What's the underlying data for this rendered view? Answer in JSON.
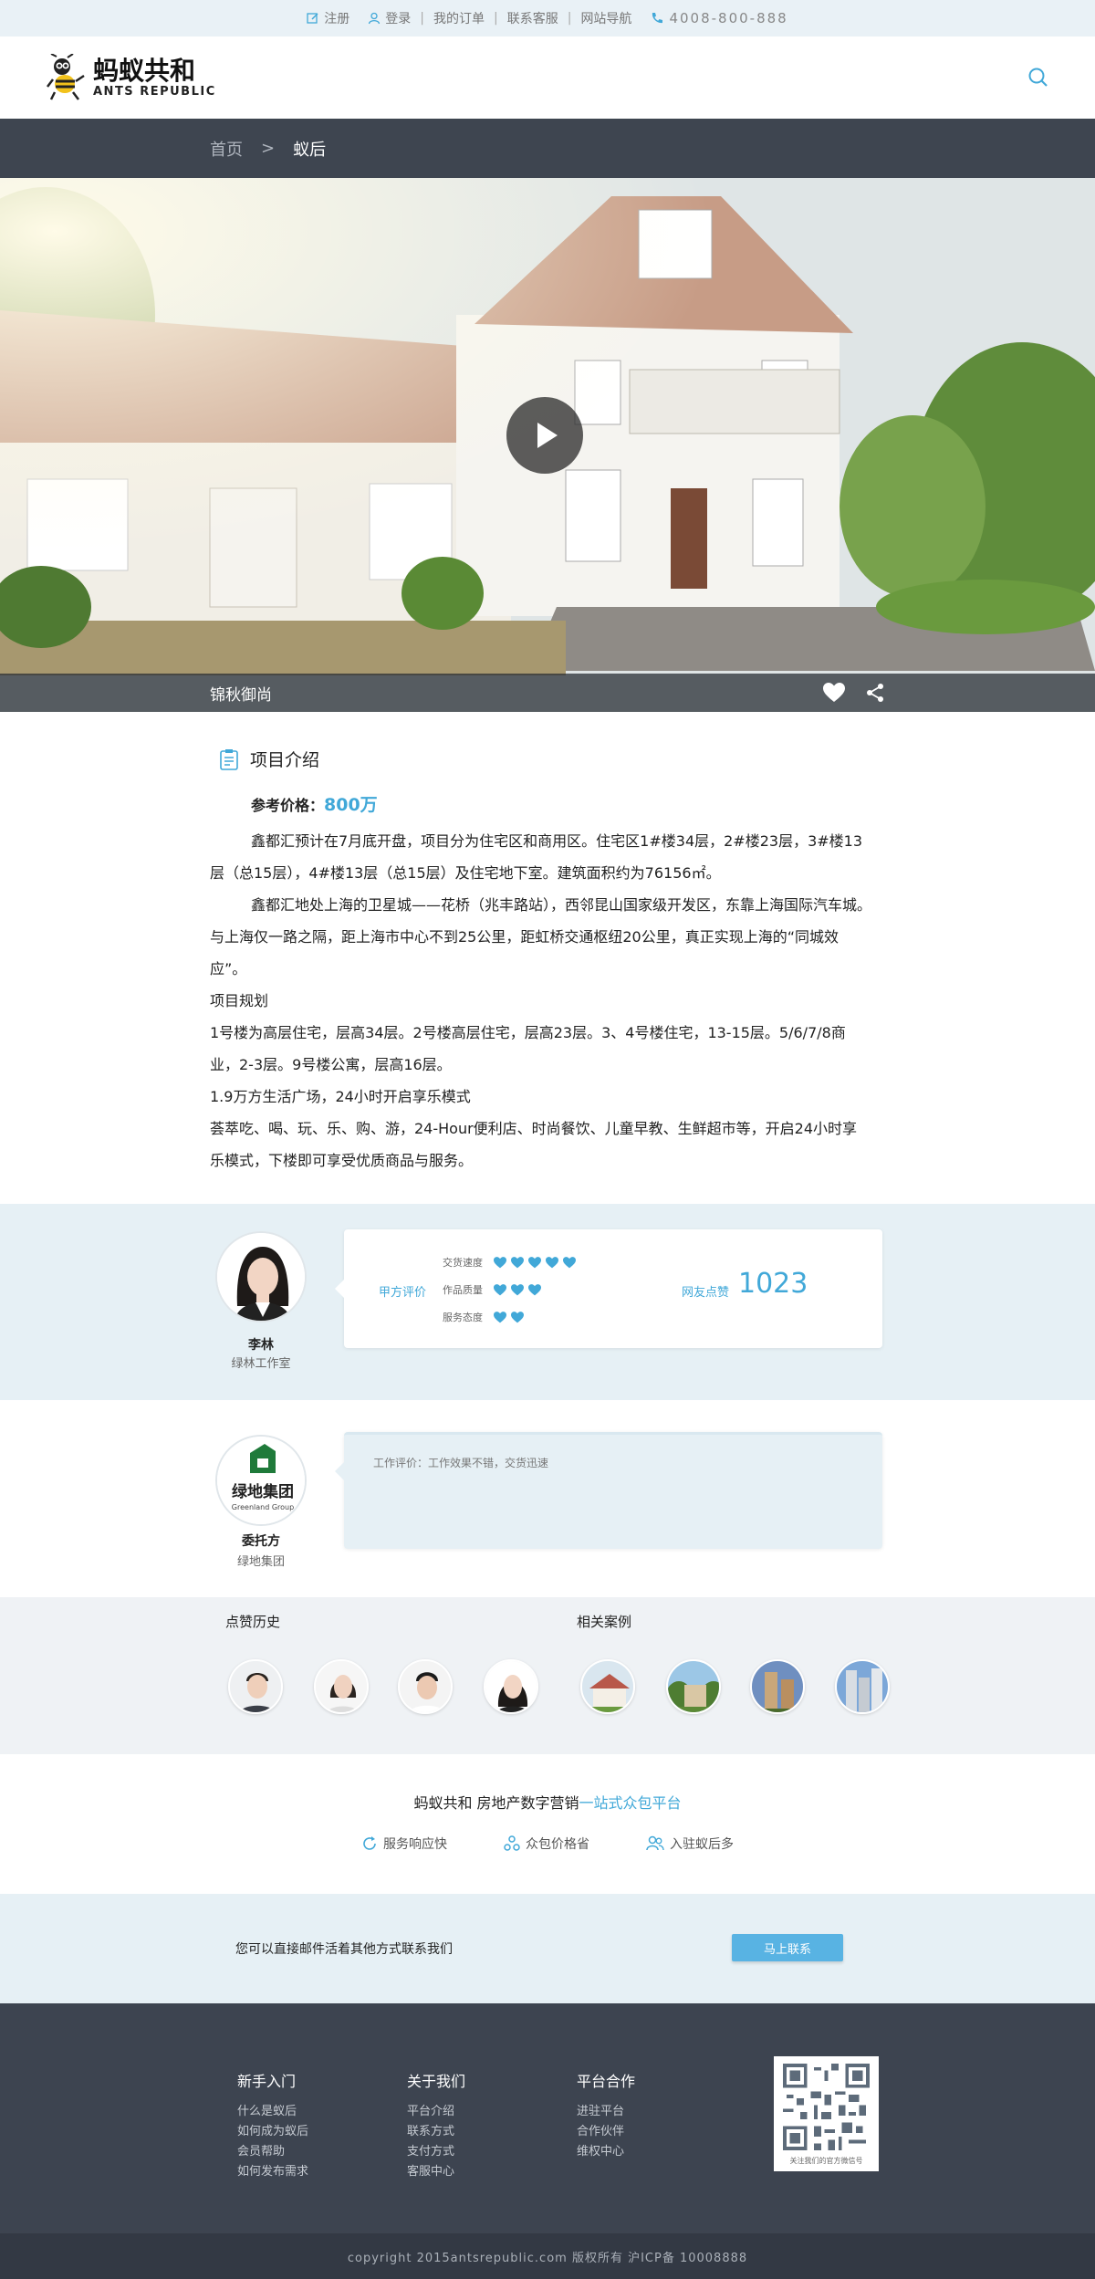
{
  "topbar": {
    "register": "注册",
    "login": "登录",
    "orders": "我的订单",
    "service": "联系客服",
    "sitenav": "网站导航",
    "phone": "4008-800-888"
  },
  "logo": {
    "cn": "蚂蚁共和",
    "en": "ANTS REPUBLIC"
  },
  "breadcrumb": {
    "home": "首页",
    "sep": ">",
    "current": "蚁后"
  },
  "hero": {
    "caption": "锦秋御尚"
  },
  "intro": {
    "title": "项目介绍",
    "price_label": "参考价格：",
    "price_value": "800万",
    "para1": "鑫都汇预计在7月底开盘，项目分为住宅区和商用区。住宅区1#楼34层，2#楼23层，3#楼13层（总15层），4#楼13层（总15层）及住宅地下室。建筑面积约为76156㎡。",
    "para2": "鑫都汇地处上海的卫星城——花桥（兆丰路站），西邻昆山国家级开发区，东靠上海国际汽车城。与上海仅一路之隔，距上海市中心不到25公里，距虹桥交通枢纽20公里，真正实现上海的“同城效应”。",
    "para3": "项目规划",
    "para4": "1号楼为高层住宅，层高34层。2号楼高层住宅，层高23层。3、4号楼住宅，13-15层。5/6/7/8商业，2-3层。9号楼公寓，层高16层。",
    "para5": "1.9万方生活广场，24小时开启享乐模式",
    "para6": "荟萃吃、喝、玩、乐、购、游，24-Hour便利店、时尚餐饮、儿童早教、生鲜超市等，开启24小时享乐模式，下楼即可享受优质商品与服务。"
  },
  "review1": {
    "name": "李林",
    "studio": "绿林工作室",
    "eval_label": "甲方评价",
    "ratings": [
      {
        "label": "交货速度",
        "value": 5
      },
      {
        "label": "作品质量",
        "value": 3
      },
      {
        "label": "服务态度",
        "value": 2
      }
    ],
    "likes_label": "网友点赞",
    "likes_value": "1023"
  },
  "review2": {
    "logo_cn": "绿地集团",
    "logo_en": "Greenland Group",
    "name": "委托方",
    "company": "绿地集团",
    "comment": "工作评价：工作效果不错，交货迅速"
  },
  "history": {
    "likes_title": "点赞历史",
    "cases_title": "相关案例"
  },
  "slogan": {
    "main": "蚂蚁共和 房地产数字营销",
    "highlight": "一站式众包平台",
    "features": [
      "服务响应快",
      "众包价格省",
      "入驻蚁后多"
    ]
  },
  "contact": {
    "text": "您可以直接邮件活着其他方式联系我们",
    "button": "马上联系"
  },
  "footer": {
    "col1": {
      "title": "新手入门",
      "items": [
        "什么是蚁后",
        "如何成为蚁后",
        "会员帮助",
        "如何发布需求"
      ]
    },
    "col2": {
      "title": "关于我们",
      "items": [
        "平台介绍",
        "联系方式",
        "支付方式",
        "客服中心"
      ]
    },
    "col3": {
      "title": "平台合作",
      "items": [
        "进驻平台",
        "合作伙伴",
        "维权中心"
      ]
    },
    "qr_caption": "关注我们的官方微信号",
    "copyright": "copyright 2015antsrepublic.com 版权所有 沪ICP备 10008888"
  },
  "colors": {
    "accent": "#41a8d8",
    "dark": "#3e4550",
    "light": "#e6f0f5"
  }
}
